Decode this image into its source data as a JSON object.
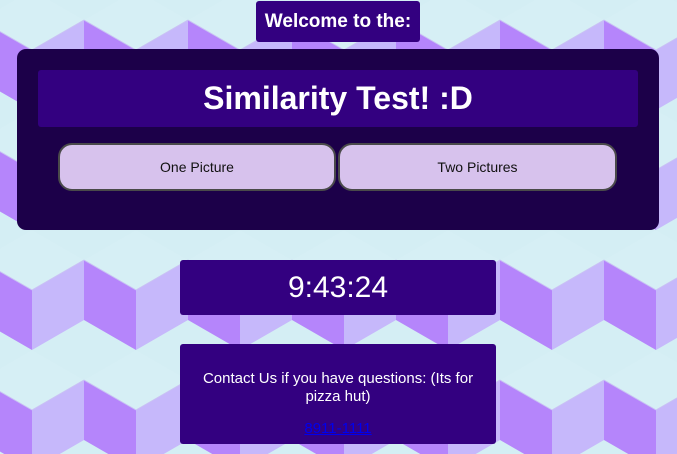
{
  "welcome": {
    "text": "Welcome to the:"
  },
  "title": {
    "text": "Similarity Test! :D"
  },
  "buttons": {
    "one_picture": "One Picture",
    "two_pictures": "Two Pictures"
  },
  "clock": {
    "time": "9:43:24"
  },
  "contact": {
    "message": "Contact Us if you have questions: (Its for pizza hut)",
    "phone": "8911-1111"
  },
  "colors": {
    "panel_dark": "#1c0049",
    "panel_purple": "#330080",
    "button_lavender": "#d7c2ed",
    "bg_light_cyan": "#d4eef4",
    "bg_violet": "#b07ffa",
    "bg_lilac": "#c5b6fa"
  }
}
